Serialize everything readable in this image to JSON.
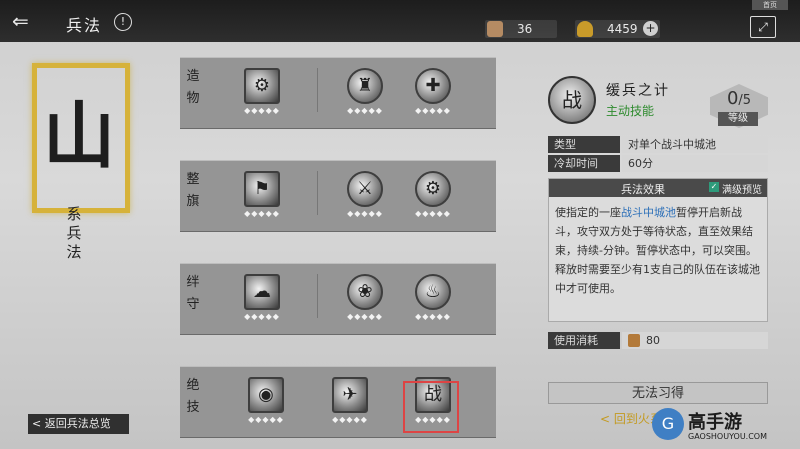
{
  "header": {
    "back_symbol": "⇐",
    "title": "兵法",
    "info_symbol": "!",
    "resources": [
      {
        "icon": "token-icon",
        "value": "36",
        "color": "#b58b63"
      },
      {
        "icon": "gold-ingot-icon",
        "value": "4459",
        "color": "#c99b2a"
      }
    ],
    "plus_symbol": "+",
    "exit_label": "⤢",
    "top_tag": "首页"
  },
  "left_panel": {
    "big_char": "山",
    "vertical_title": "系兵法",
    "back_all_label": "< 返回兵法总览"
  },
  "rows": [
    {
      "label": "造物",
      "skills": [
        {
          "name": "skill-1-1",
          "glyph": "⚙",
          "shape": "square",
          "dots": "◆◆◆◆◆"
        },
        {
          "name": "skill-1-2",
          "glyph": "♜",
          "shape": "circle",
          "dots": "◆◆◆◆◆"
        },
        {
          "name": "skill-1-3",
          "glyph": "✚",
          "shape": "circle",
          "dots": "◆◆◆◆◆"
        }
      ]
    },
    {
      "label": "整旗",
      "skills": [
        {
          "name": "skill-2-1",
          "glyph": "⚑",
          "shape": "square",
          "dots": "◆◆◆◆◆"
        },
        {
          "name": "skill-2-2",
          "glyph": "⚔",
          "shape": "circle",
          "dots": "◆◆◆◆◆"
        },
        {
          "name": "skill-2-3",
          "glyph": "⚙",
          "shape": "circle",
          "dots": "◆◆◆◆◆"
        }
      ]
    },
    {
      "label": "绊守",
      "skills": [
        {
          "name": "skill-3-1",
          "glyph": "☁",
          "shape": "square",
          "dots": "◆◆◆◆◆"
        },
        {
          "name": "skill-3-2",
          "glyph": "❀",
          "shape": "circle",
          "dots": "◆◆◆◆◆"
        },
        {
          "name": "skill-3-3",
          "glyph": "♨",
          "shape": "circle",
          "dots": "◆◆◆◆◆"
        }
      ]
    },
    {
      "label": "绝技",
      "skills": [
        {
          "name": "skill-4-1",
          "glyph": "◉",
          "shape": "square",
          "dots": "◆◆◆◆◆"
        },
        {
          "name": "skill-4-2",
          "glyph": "✈",
          "shape": "square",
          "dots": "◆◆◆◆◆"
        },
        {
          "name": "skill-4-3",
          "glyph": "战",
          "shape": "square",
          "dots": "◆◆◆◆◆"
        }
      ]
    }
  ],
  "detail": {
    "icon_glyph": "战",
    "name": "缓兵之计",
    "type_label": "主动技能",
    "level_value": "0",
    "level_sep": "/",
    "level_max": "5",
    "level_caption": "等级",
    "type_key": "类型",
    "type_value": "对单个战斗中城池",
    "cooldown_key": "冷却时间",
    "cooldown_value": "60分",
    "effect_title": "兵法效果",
    "preview_check": "✓",
    "preview_label": "满级预览",
    "effect_pre": "使指定的一座",
    "effect_highlight": "战斗中城池",
    "effect_post": "暂停开启新战斗，攻守双方处于等待状态，直至效果结束，持续-分钟。暂停状态中，可以突围。释放时需要至少有1支自己的队伍在该城池中才可使用。",
    "cost_key": "使用消耗",
    "cost_value": "80",
    "learn_button": "无法习得",
    "goto_label": "< 回到火系"
  },
  "watermark": {
    "mark": "G",
    "text": "高手游",
    "sub": "GAOSHOUYOU.COM"
  }
}
